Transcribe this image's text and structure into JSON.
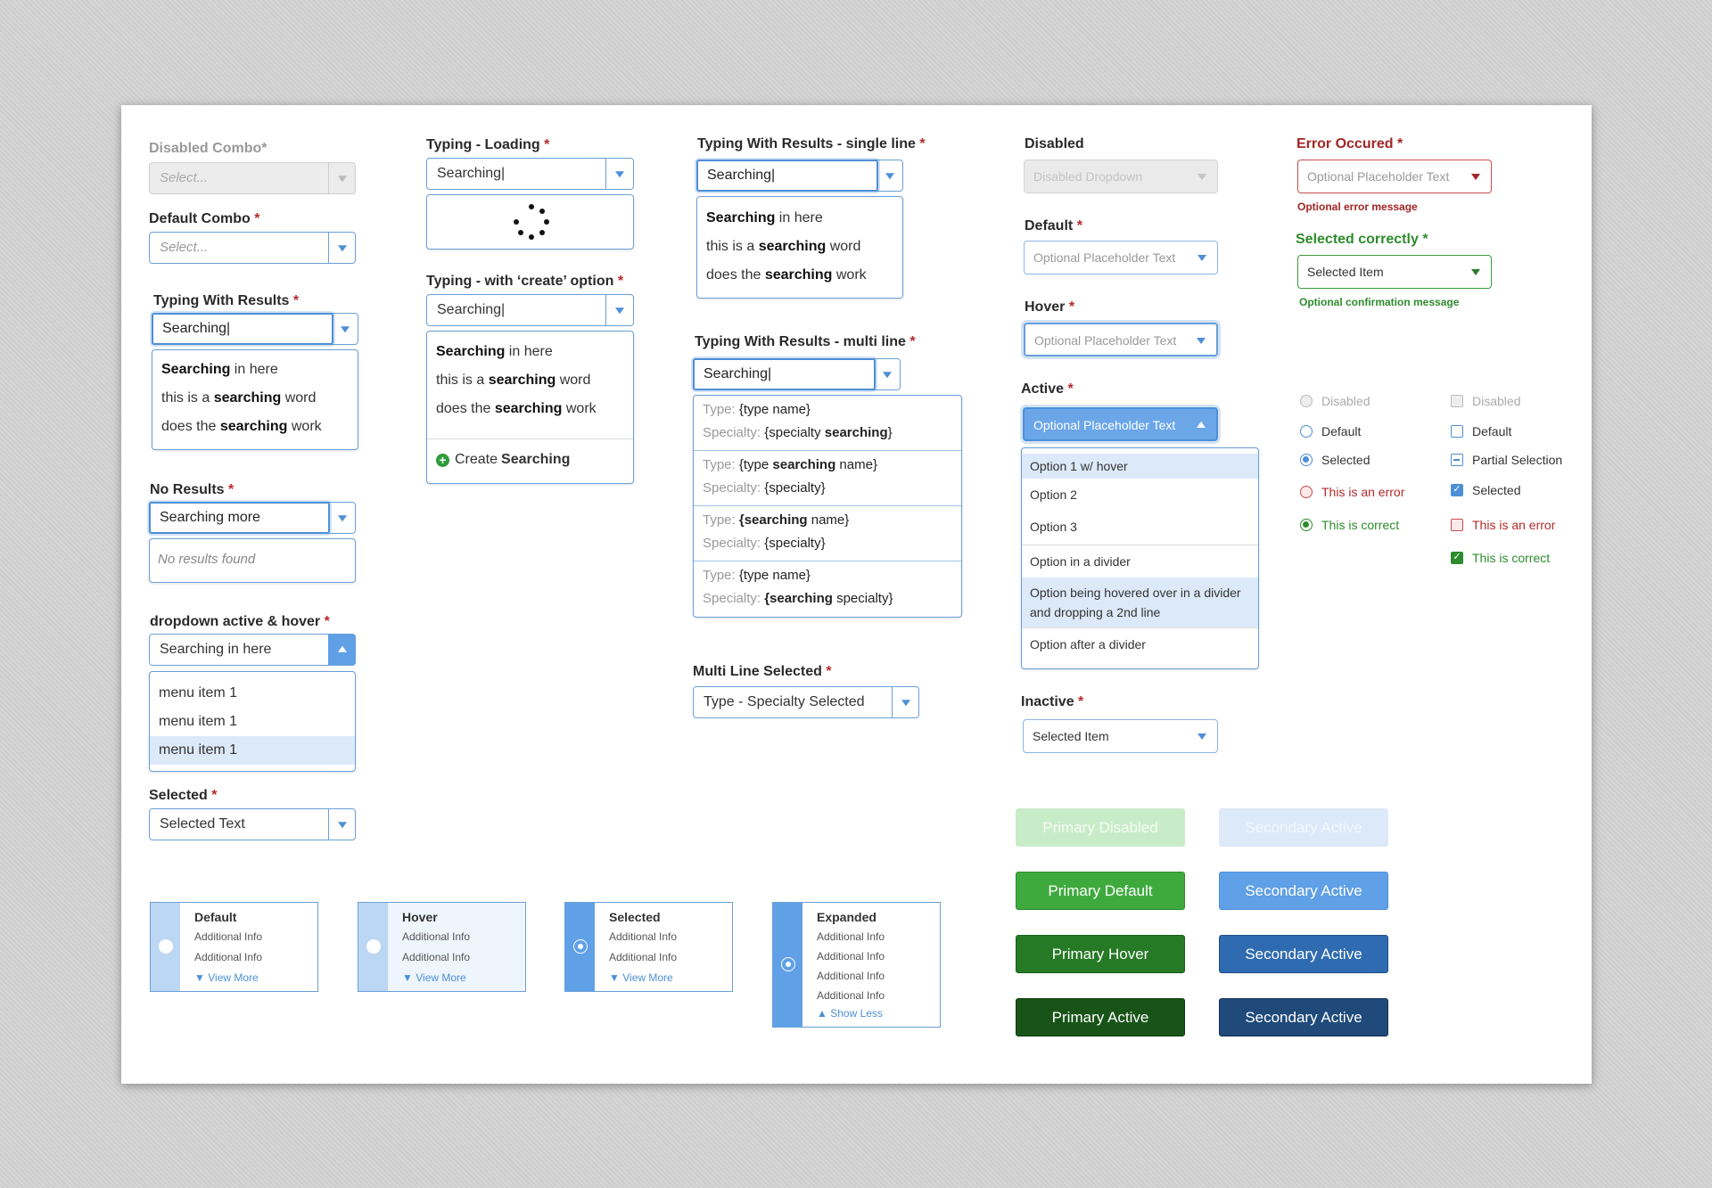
{
  "col1": {
    "disabled_combo": {
      "label": "Disabled Combo*",
      "placeholder": "Select..."
    },
    "default_combo": {
      "label": "Default Combo",
      "placeholder": "Select..."
    },
    "typing_results": {
      "label": "Typing With Results",
      "value": "Searching|",
      "results": [
        {
          "bold": "Searching",
          "after": " in here"
        },
        {
          "before": "this is a ",
          "bold": "searching",
          "after": " word"
        },
        {
          "before": "does the ",
          "bold": "searching",
          "after": " work"
        }
      ]
    },
    "no_results": {
      "label": "No Results",
      "value": "Searching more",
      "empty": "No results found"
    },
    "active_hover": {
      "label": "dropdown active & hover",
      "value": "Searching in here",
      "items": [
        "menu item 1",
        "menu item 1",
        "menu item 1"
      ]
    },
    "selected": {
      "label": "Selected",
      "value": "Selected Text"
    }
  },
  "col2": {
    "loading": {
      "label": "Typing - Loading",
      "value": "Searching|"
    },
    "create": {
      "label": "Typing - with ‘create’ option",
      "value": "Searching|",
      "results": [
        {
          "bold": "Searching",
          "after": " in here"
        },
        {
          "before": "this is a ",
          "bold": "searching",
          "after": " word"
        },
        {
          "before": "does the ",
          "bold": "searching",
          "after": " work"
        }
      ],
      "create_prefix": "Create ",
      "create_bold": "Searching"
    }
  },
  "col3": {
    "single": {
      "label": "Typing With Results - single line",
      "value": "Searching|",
      "results": [
        {
          "bold": "Searching",
          "after": " in here"
        },
        {
          "before": "this is a ",
          "bold": "searching",
          "after": " word"
        },
        {
          "before": "does the ",
          "bold": "searching",
          "after": " work"
        }
      ]
    },
    "multi": {
      "label": "Typing With Results - multi line",
      "value": "Searching|",
      "type_label": "Type:",
      "specialty_label": "Specialty:",
      "rows": [
        {
          "t_pre": "{type name}",
          "t_bold": "",
          "t_post": "",
          "s_pre": "{specialty ",
          "s_bold": "searching",
          "s_post": "}"
        },
        {
          "t_pre": "{type ",
          "t_bold": "searching",
          "t_post": " name}",
          "s_pre": "{specialty}",
          "s_bold": "",
          "s_post": ""
        },
        {
          "t_pre": "",
          "t_bold": "{searching",
          "t_post": " name}",
          "s_pre": "{specialty}",
          "s_bold": "",
          "s_post": ""
        },
        {
          "t_pre": "{type name}",
          "t_bold": "",
          "t_post": "",
          "s_pre": "",
          "s_bold": "{searching",
          "s_post": " specialty}"
        }
      ]
    },
    "multi_selected": {
      "label": "Multi Line Selected",
      "value": "Type - Specialty Selected"
    }
  },
  "col4": {
    "disabled": {
      "label": "Disabled",
      "value": "Disabled Dropdown"
    },
    "default": {
      "label": "Default",
      "value": "Optional Placeholder Text"
    },
    "hover": {
      "label": "Hover",
      "value": "Optional Placeholder Text"
    },
    "active": {
      "label": "Active",
      "value": "Optional Placeholder Text",
      "options": [
        "Option 1 w/ hover",
        "Option 2",
        "Option 3",
        "Option in a divider",
        "Option being hovered over in a divider and dropping a 2nd line",
        "Option after a divider"
      ]
    },
    "inactive": {
      "label": "Inactive",
      "value": "Selected Item"
    }
  },
  "col5": {
    "error": {
      "label": "Error Occured",
      "value": "Optional Placeholder Text",
      "message": "Optional error message"
    },
    "correct": {
      "label": "Selected correctly",
      "value": "Selected Item",
      "message": "Optional confirmation message"
    },
    "radios": [
      "Disabled",
      "Default",
      "Selected",
      "This is an error",
      "This is correct"
    ],
    "checks": [
      "Disabled",
      "Default",
      "Partial Selection",
      "Selected",
      "This is an error",
      "This is correct"
    ]
  },
  "buttons": {
    "primary": [
      "Primary Disabled",
      "Primary Default",
      "Primary Hover",
      "Primary Active"
    ],
    "secondary": [
      "Secondary Active",
      "Secondary Active",
      "Secondary Active",
      "Secondary Active"
    ]
  },
  "tiles": [
    {
      "title": "Default",
      "infos": [
        "Additional Info",
        "Additional Info"
      ],
      "link": "View More"
    },
    {
      "title": "Hover",
      "infos": [
        "Additional Info",
        "Additional Info"
      ],
      "link": "View More"
    },
    {
      "title": "Selected",
      "infos": [
        "Additional Info",
        "Additional Info"
      ],
      "link": "View More"
    },
    {
      "title": "Expanded",
      "infos": [
        "Additional Info",
        "Additional Info",
        "Additional Info",
        "Additional Info"
      ],
      "link": "Show Less"
    }
  ],
  "colors": {
    "accent": "#4d8fd6",
    "error": "#b52a2a",
    "success": "#2e8b2e",
    "primary": "#3eaa3e",
    "secondary": "#5fa0e6"
  },
  "icons": {
    "dropdown": "chevron-down-icon",
    "create": "plus-circle-icon",
    "radio": "radio-icon",
    "checkbox": "checkbox-icon"
  }
}
